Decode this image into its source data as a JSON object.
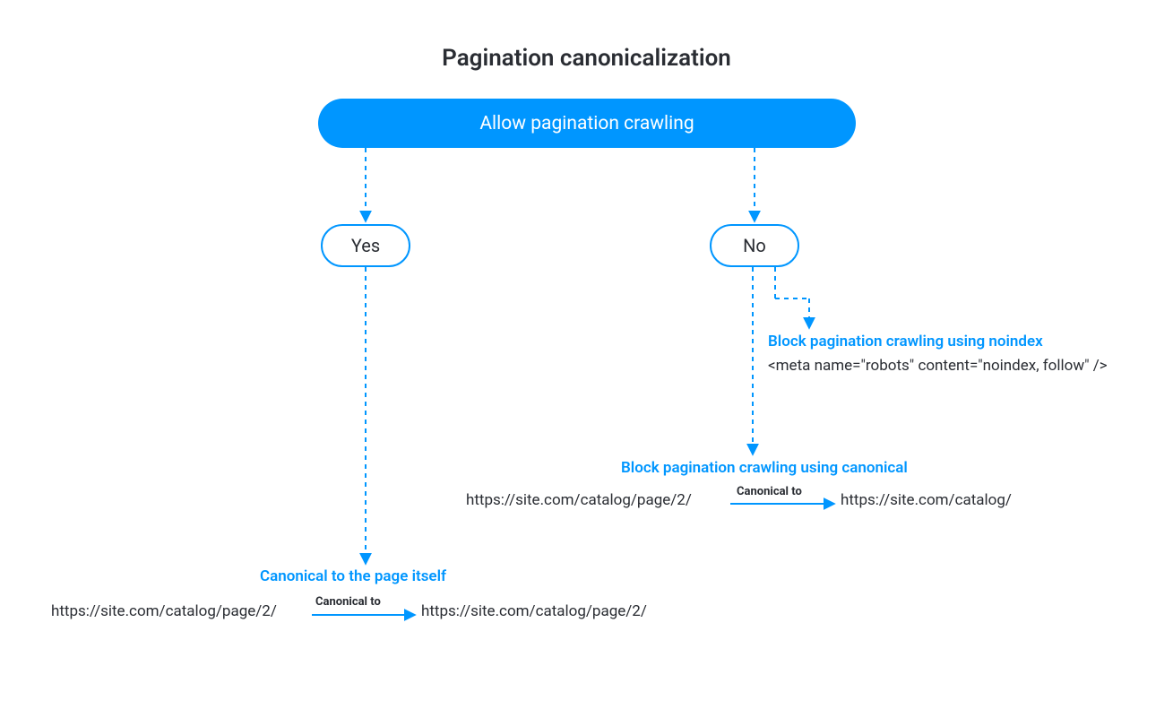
{
  "title": "Pagination canonicalization",
  "root": {
    "label": "Allow pagination crawling"
  },
  "choices": {
    "yes": "Yes",
    "no": "No"
  },
  "noindex": {
    "heading": "Block pagination crawling using noindex",
    "code": "<meta name=\"robots\" content=\"noindex, follow\" />"
  },
  "canonical_block": {
    "heading": "Block pagination crawling using canonical",
    "from": "https://site.com/catalog/page/2/",
    "label": "Canonical to",
    "to": "https://site.com/catalog/"
  },
  "self_canonical": {
    "heading": "Canonical to the page itself",
    "from": "https://site.com/catalog/page/2/",
    "label": "Canonical to",
    "to": "https://site.com/catalog/page/2/"
  }
}
